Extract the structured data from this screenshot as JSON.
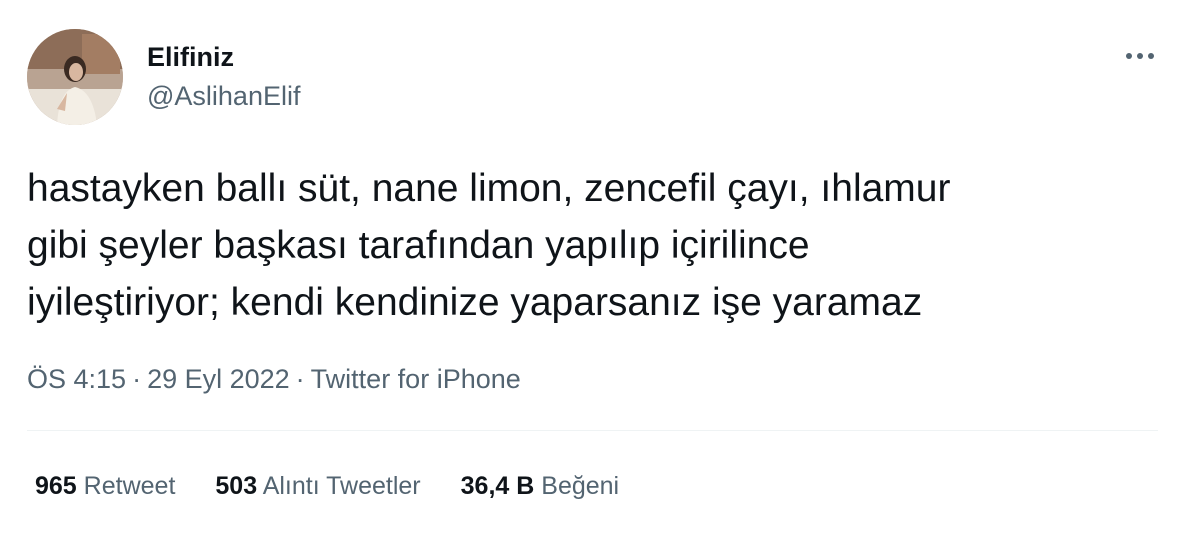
{
  "author": {
    "display_name": "Elifiniz",
    "handle": "@AslihanElif"
  },
  "tweet": {
    "lines": [
      "hastayken ballı süt, nane limon, zencefil çayı, ıhlamur",
      "gibi şeyler başkası tarafından yapılıp içirilince",
      "iyileştiriyor; kendi kendinize yaparsanız işe yaramaz"
    ]
  },
  "meta": {
    "time": "ÖS 4:15",
    "separator": "·",
    "date": "29 Eyl 2022",
    "source": "Twitter for iPhone"
  },
  "stats": {
    "retweets": {
      "count": "965",
      "label": "Retweet"
    },
    "quotes": {
      "count": "503",
      "label": "Alıntı Tweetler"
    },
    "likes": {
      "count": "36,4 B",
      "label": "Beğeni"
    }
  },
  "icons": {
    "more": "more-horizontal-icon"
  },
  "colors": {
    "text_primary": "#0f1419",
    "text_secondary": "#536471",
    "divider": "#eff3f4"
  }
}
